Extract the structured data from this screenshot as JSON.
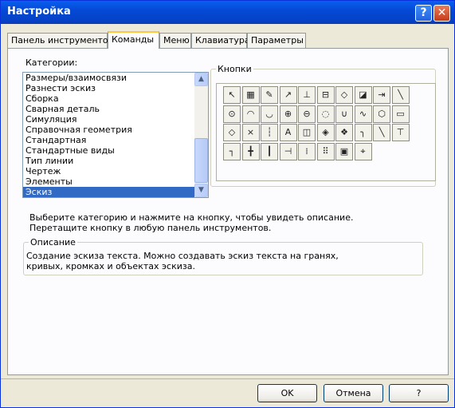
{
  "window": {
    "title": "Настройка"
  },
  "titlebar": {
    "help_label": "?",
    "close_label": "✕"
  },
  "tabs": [
    {
      "label": "Панель инструментов"
    },
    {
      "label": "Команды"
    },
    {
      "label": "Меню"
    },
    {
      "label": "Клавиатура"
    },
    {
      "label": "Параметры"
    }
  ],
  "active_tab": "Команды",
  "categories": {
    "label": "Категории:",
    "items": [
      "Размеры/взаимосвязи",
      "Разнести эскиз",
      "Сборка",
      "Сварная деталь",
      "Симуляция",
      "Справочная геометрия",
      "Стандартная",
      "Стандартные виды",
      "Тип линии",
      "Чертеж",
      "Элементы",
      "Эскиз"
    ],
    "selected": "Эскиз"
  },
  "buttons_group": {
    "label": "Кнопки",
    "icons": [
      "pointer-icon",
      "grid-icon",
      "edit-sketch-icon",
      "smart-dimension-icon",
      "add-relation-icon",
      "display-relations-icon",
      "sketch-plane-icon",
      "sketch-3d-icon",
      "insert-block-icon",
      "line-icon",
      "circle-icon",
      "arc-center-icon",
      "tangent-arc-icon",
      "three-point-arc-icon",
      "ellipse-icon",
      "partial-ellipse-icon",
      "parabola-icon",
      "spline-icon",
      "polygon-icon",
      "rectangle-icon",
      "parallelogram-icon",
      "point-icon",
      "centerline-icon",
      "text-icon",
      "convert-entities-icon",
      "offset-entities-icon",
      "mirror-icon",
      "fillet-icon",
      "chamfer-icon",
      "trim-icon",
      "extend-icon",
      "split-icon",
      "construction-icon",
      "intersection-icon",
      "linear-pattern-icon",
      "circular-pattern-icon",
      "sketch-picture-icon",
      "modify-icon"
    ]
  },
  "hint": {
    "line1": "Выберите категорию и нажмите на кнопку, чтобы увидеть описание.",
    "line2": "Перетащите кнопку в любую панель инструментов."
  },
  "description": {
    "label": "Описание",
    "line1": "Создание эскиза текста. Можно создавать эскиз текста на гранях,",
    "line2": "кривых, кромках и объектах эскиза."
  },
  "footer": {
    "ok_label": "OK",
    "cancel_label": "Отмена",
    "help_label": "?"
  },
  "colors": {
    "selection": "#316AC5",
    "title_bar": "#0549D6",
    "tab_highlight": "#FFC83C"
  }
}
